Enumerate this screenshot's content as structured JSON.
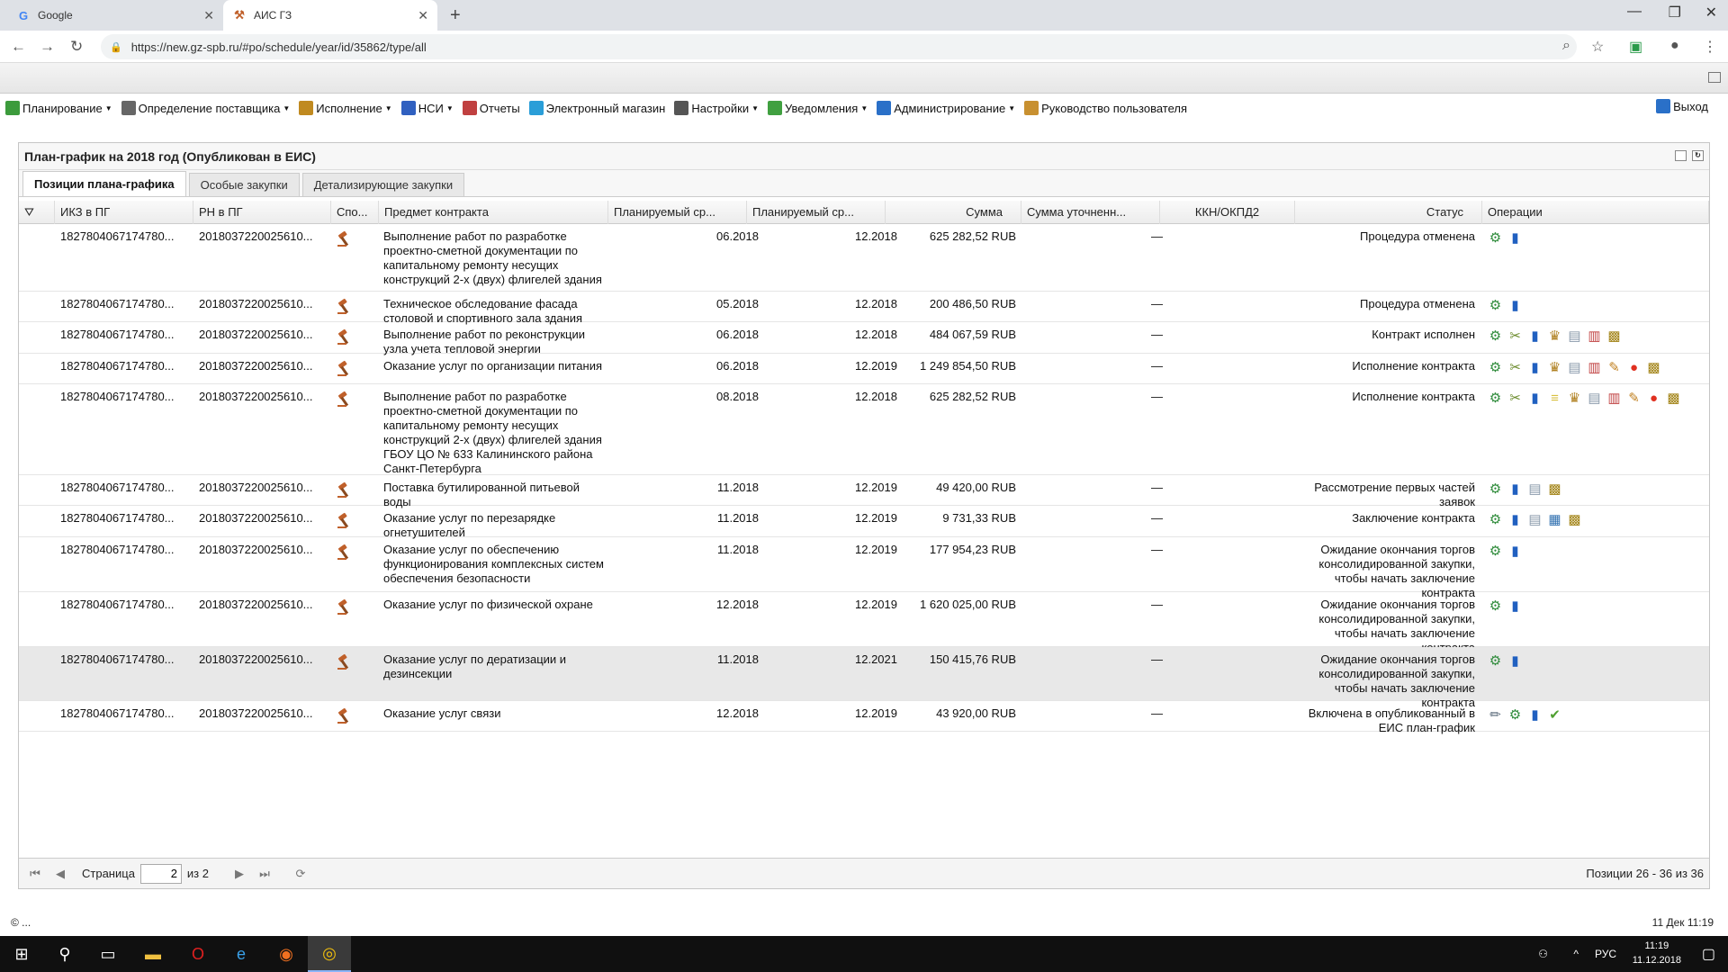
{
  "browser": {
    "tabs": [
      {
        "title": "Google",
        "active": false
      },
      {
        "title": "АИС ГЗ",
        "active": true
      }
    ],
    "url": "https://new.gz-spb.ru/#po/schedule/year/id/35862/type/all"
  },
  "menu": {
    "items": [
      {
        "label": "Планирование",
        "caret": true,
        "color": "#3c9b3c"
      },
      {
        "label": "Определение поставщика",
        "caret": true,
        "color": "#666666"
      },
      {
        "label": "Исполнение",
        "caret": true,
        "color": "#c08a20"
      },
      {
        "label": "НСИ",
        "caret": true,
        "color": "#3060c0"
      },
      {
        "label": "Отчеты",
        "caret": false,
        "color": "#c04040"
      },
      {
        "label": "Электронный магазин",
        "caret": false,
        "color": "#2a9ed8"
      },
      {
        "label": "Настройки",
        "caret": true,
        "color": "#555555"
      },
      {
        "label": "Уведомления",
        "caret": true,
        "color": "#40a040"
      },
      {
        "label": "Администрирование",
        "caret": true,
        "color": "#2a70c8"
      },
      {
        "label": "Руководство пользователя",
        "caret": false,
        "color": "#c89030"
      }
    ],
    "exit_label": "Выход"
  },
  "panel": {
    "title": "План-график на 2018 год (Опубликован в ЕИС)",
    "tabs": [
      "Позиции плана-графика",
      "Особые закупки",
      "Детализирующие закупки"
    ]
  },
  "grid": {
    "columns": [
      "ИКЗ в ПГ",
      "РН в ПГ",
      "Спо...",
      "Предмет контракта",
      "Планируемый ср...",
      "Планируемый ср...",
      "Сумма",
      "Сумма уточненн...",
      "ККН/ОКПД2",
      "Статус",
      "Операции"
    ],
    "rows": [
      {
        "ikz": "1827804067174780...",
        "rn": "2018037220025610...",
        "subject": "Выполнение работ по разработке проектно-сметной документации по капитальному ремонту несущих конструкций 2-х (двух) флигелей здания",
        "start": "06.2018",
        "end": "12.2018",
        "sum": "625 282,52 RUB",
        "sum2": "—",
        "status": "Процедура отменена",
        "ops": [
          "gear",
          "chart"
        ]
      },
      {
        "ikz": "1827804067174780...",
        "rn": "2018037220025610...",
        "subject": "Техническое обследование фасада столовой и спортивного зала здания",
        "start": "05.2018",
        "end": "12.2018",
        "sum": "200 486,50 RUB",
        "sum2": "—",
        "status": "Процедура отменена",
        "ops": [
          "gear",
          "chart"
        ]
      },
      {
        "ikz": "1827804067174780...",
        "rn": "2018037220025610...",
        "subject": "Выполнение работ по реконструкции узла учета тепловой энергии",
        "start": "06.2018",
        "end": "12.2018",
        "sum": "484 067,59 RUB",
        "sum2": "—",
        "status": "Контракт исполнен",
        "ops": [
          "gear",
          "tools",
          "chart",
          "eagle",
          "doc",
          "docred",
          "scroll"
        ]
      },
      {
        "ikz": "1827804067174780...",
        "rn": "2018037220025610...",
        "subject": "Оказание услуг по организации питания",
        "start": "06.2018",
        "end": "12.2019",
        "sum": "1 249 854,50 RUB",
        "sum2": "—",
        "status": "Исполнение контракта",
        "ops": [
          "gear",
          "tools",
          "chart",
          "eagle",
          "doc",
          "docred",
          "pencil",
          "stop",
          "scroll"
        ]
      },
      {
        "ikz": "1827804067174780...",
        "rn": "2018037220025610...",
        "subject": "Выполнение работ по разработке проектно-сметной документации по капитальному ремонту несущих конструкций 2-х (двух) флигелей здания ГБОУ ЦО № 633 Калининского района Санкт-Петербурга",
        "start": "08.2018",
        "end": "12.2018",
        "sum": "625 282,52 RUB",
        "sum2": "—",
        "status": "Исполнение контракта",
        "ops": [
          "gear",
          "tools",
          "chart",
          "note",
          "eagle",
          "doc",
          "docred",
          "pencil",
          "stop",
          "scroll"
        ]
      },
      {
        "ikz": "1827804067174780...",
        "rn": "2018037220025610...",
        "subject": "Поставка бутилированной питьевой воды",
        "start": "11.2018",
        "end": "12.2019",
        "sum": "49 420,00 RUB",
        "sum2": "—",
        "status": "Рассмотрение первых частей заявок",
        "ops": [
          "gear",
          "chart",
          "doc",
          "scroll"
        ]
      },
      {
        "ikz": "1827804067174780...",
        "rn": "2018037220025610...",
        "subject": "Оказание услуг по перезарядке огнетушителей",
        "start": "11.2018",
        "end": "12.2019",
        "sum": "9 731,33 RUB",
        "sum2": "—",
        "status": "Заключение контракта",
        "ops": [
          "gear",
          "chart",
          "doc",
          "docblue",
          "scroll"
        ]
      },
      {
        "ikz": "1827804067174780...",
        "rn": "2018037220025610...",
        "subject": "Оказание услуг по обеспечению функционирования комплексных систем обеспечения безопасности",
        "start": "11.2018",
        "end": "12.2019",
        "sum": "177 954,23 RUB",
        "sum2": "—",
        "status": "Ожидание окончания торгов консолидированной закупки, чтобы начать заключение контракта",
        "ops": [
          "gear",
          "chart"
        ]
      },
      {
        "ikz": "1827804067174780...",
        "rn": "2018037220025610...",
        "subject": "Оказание услуг по физической охране",
        "start": "12.2018",
        "end": "12.2019",
        "sum": "1 620 025,00 RUB",
        "sum2": "—",
        "status": "Ожидание окончания торгов консолидированной закупки, чтобы начать заключение контракта",
        "ops": [
          "gear",
          "chart"
        ]
      },
      {
        "ikz": "1827804067174780...",
        "rn": "2018037220025610...",
        "subject": "Оказание услуг по дератизации и дезинсекции",
        "start": "11.2018",
        "end": "12.2021",
        "sum": "150 415,76 RUB",
        "sum2": "—",
        "status": "Ожидание окончания торгов консолидированной закупки, чтобы начать заключение контракта",
        "ops": [
          "gear",
          "chart"
        ]
      },
      {
        "ikz": "1827804067174780...",
        "rn": "2018037220025610...",
        "subject": "Оказание услуг связи",
        "start": "12.2018",
        "end": "12.2019",
        "sum": "43 920,00 RUB",
        "sum2": "—",
        "status": "Включена в опубликованный в ЕИС план-график",
        "ops": [
          "pen",
          "gear",
          "chart",
          "check"
        ]
      }
    ]
  },
  "pager": {
    "page_label": "Страница",
    "page_value": "2",
    "of_label": "из 2",
    "info": "Позиции 26 - 36 из 36"
  },
  "footer": {
    "left": "© ...",
    "right": "11 Дек 11:19"
  },
  "taskbar": {
    "lang": "РУС",
    "time": "11:19",
    "date": "11.12.2018"
  }
}
